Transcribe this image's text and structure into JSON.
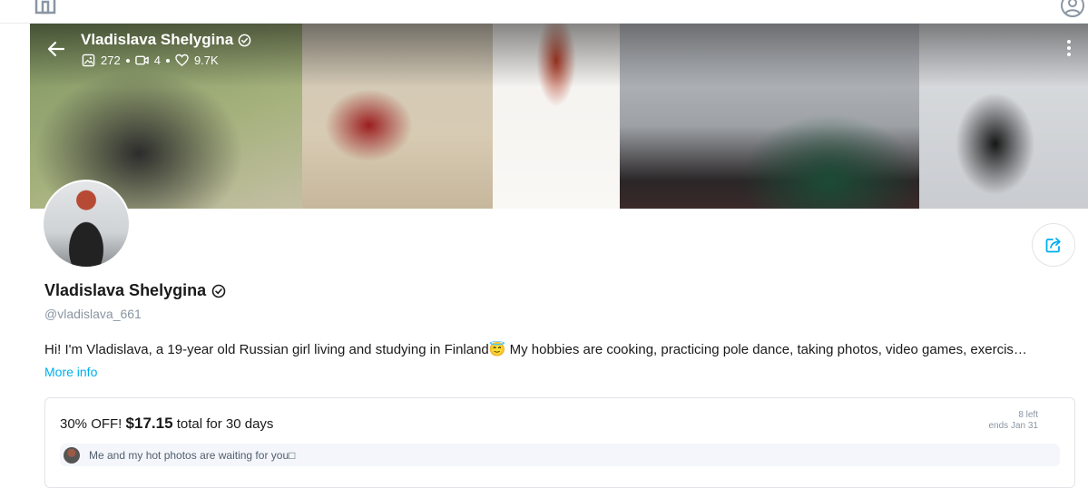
{
  "profile": {
    "name": "Vladislava Shelygina",
    "handle": "@vladislava_661",
    "bio": "Hi! I'm Vladislava, a 19-year old Russian girl living and studying in Finland😇 My hobbies are cooking, practicing pole dance, taking photos, video games, exercis…",
    "more_info_label": "More info"
  },
  "stats": {
    "photos": "272",
    "videos": "4",
    "likes": "9.7K"
  },
  "subscription": {
    "discount": "30% OFF!",
    "price": "$17.15",
    "period": "total for 30 days",
    "left": "8 left",
    "ends": "ends Jan 31",
    "message": "Me and my hot photos are waiting for you□"
  },
  "colors": {
    "accent": "#00aff0",
    "muted": "#8a96a3"
  },
  "icons": [
    "home-icon",
    "account-icon",
    "back-arrow-icon",
    "verified-icon",
    "image-icon",
    "video-icon",
    "heart-icon",
    "kebab-menu-icon",
    "share-icon"
  ]
}
